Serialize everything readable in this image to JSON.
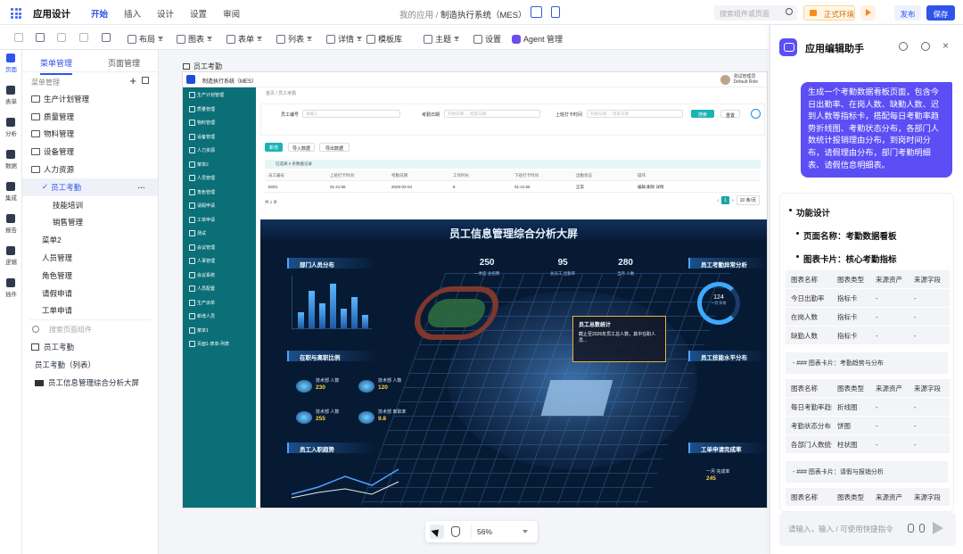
{
  "app": {
    "title": "应用设计",
    "breadcrumb_parent": "我的应用",
    "breadcrumb_sep": "/",
    "breadcrumb_current": "制造执行系统（MES）"
  },
  "top_tabs": [
    "开始",
    "插入",
    "设计",
    "设置",
    "审阅"
  ],
  "top_right": {
    "search_placeholder": "搜索组件或页面",
    "env_label": "正式环境",
    "publish": "发布",
    "save": "保存"
  },
  "toolbar": [
    {
      "label": "布局",
      "icon": "layout-icon"
    },
    {
      "label": "图表",
      "icon": "chart-icon"
    },
    {
      "label": "表单",
      "icon": "form-icon"
    },
    {
      "label": "列表",
      "icon": "list-icon"
    },
    {
      "label": "详情",
      "icon": "detail-icon"
    },
    {
      "label": "模板库",
      "icon": "template-icon"
    },
    {
      "label": "主题",
      "icon": "theme-icon"
    },
    {
      "label": "设置",
      "icon": "settings-icon"
    },
    {
      "label": "Agent 管理",
      "icon": "agent-icon"
    }
  ],
  "rail": [
    "页面",
    "表单",
    "分析",
    "数据",
    "集成",
    "报告",
    "逻辑",
    "插件"
  ],
  "left_panel": {
    "tabs": [
      "菜单管理",
      "页面管理"
    ],
    "header": "菜单管理",
    "tree": [
      {
        "label": "生产计划管理",
        "level": 0,
        "folder": true
      },
      {
        "label": "质量管理",
        "level": 0,
        "folder": true
      },
      {
        "label": "物料管理",
        "level": 0,
        "folder": true
      },
      {
        "label": "设备管理",
        "level": 0,
        "folder": true
      },
      {
        "label": "人力资源",
        "level": 0,
        "folder": true
      },
      {
        "label": "员工考勤",
        "level": 1,
        "selected": true
      },
      {
        "label": "技能培训",
        "level": 2
      },
      {
        "label": "销售管理",
        "level": 2
      },
      {
        "label": "菜单2",
        "level": 1
      },
      {
        "label": "人员管理",
        "level": 1
      },
      {
        "label": "角色管理",
        "level": 1
      },
      {
        "label": "请假申请",
        "level": 1
      },
      {
        "label": "工单申请",
        "level": 1
      }
    ],
    "search_placeholder": "搜索页面组件",
    "pages": [
      "员工考勤",
      "员工考勤（列表）",
      "员工信息管理综合分析大屏"
    ]
  },
  "canvas": {
    "page_title": "员工考勤",
    "mes_title": "制造执行系统（MES）",
    "user_name": "测试管理员",
    "user_role": "Default Role",
    "mes_menu": [
      "生产计划管理",
      "质量管理",
      "物料管理",
      "设备管理",
      "人力资源",
      "菜单2",
      "人员管理",
      "角色管理",
      "请假申请",
      "工单申请",
      "测试",
      "会议管理",
      "人事管理",
      "会议系统",
      "人员配置",
      "生产派单",
      "新增人员",
      "菜单1",
      "页面1-表单-列表"
    ],
    "crumb": "首页 / 员工考勤",
    "filter": {
      "emp_no": "员工编号",
      "emp_no_ph": "请输入",
      "date": "考勤日期",
      "date_start": "开始日期",
      "date_end": "结束日期",
      "punch": "上班打卡时间",
      "search": "搜索",
      "reset": "重置"
    },
    "list": {
      "add": "新增",
      "import": "导入数据",
      "export": "导出数据",
      "selected": "已选择 0 条数据记录",
      "headers": [
        "员工编号",
        "上班打卡时间",
        "考勤日期",
        "工作时长",
        "下班打卡时间",
        "出勤状态",
        "操作"
      ],
      "row": [
        "E001",
        "01:41:55",
        "2026-02-04",
        "8",
        "01:41:55",
        "正常",
        "编辑  删除  详情"
      ],
      "total": "共 1 条",
      "page": "1",
      "page_size": "10 条/页"
    },
    "dashboard": {
      "title": "员工信息管理综合分析大屏",
      "sections": [
        "部门人员分布",
        "在职与离职比例",
        "员工入职趋势",
        "员工考勤异常分析",
        "员工技能水平分布",
        "工单申请完成率"
      ],
      "kpis": [
        {
          "value": "250",
          "label": "一季度 总招聘"
        },
        {
          "value": "95",
          "label": "总员工 出勤率"
        },
        {
          "value": "280",
          "label": "当月 人数"
        }
      ],
      "popup_title": "员工总数统计",
      "popup_text": "截止至2026年员工总人数，其中在职人员...",
      "ring_value": "124",
      "ring_label": "一月 异常",
      "peds": [
        {
          "label": "技术部 人数",
          "value": "230"
        },
        {
          "label": "技术部 人数",
          "value": "120"
        },
        {
          "label": "技术部 人数",
          "value": "255"
        },
        {
          "label": "技术部 离职率",
          "value": "9.8"
        }
      ],
      "completion_value": "245",
      "completion_label": "一月 完成率"
    }
  },
  "zoom": {
    "value": "56%"
  },
  "assistant": {
    "title": "应用编辑助手",
    "user_message": "生成一个考勤数据看板页面，包含今日出勤率、在岗人数、缺勤人数、迟到人数等指标卡，搭配每日考勤率趋势折线图、考勤状态分布，各部门人数统计报销理由分布，到岗时间分布，请假理由分布，部门考勤明细表、请假信息明细表。",
    "reply": {
      "h1": "功能设计",
      "page_name": "页面名称：考勤数据看板",
      "card_title": "图表卡片：核心考勤指标",
      "table_headers": [
        "图表名称",
        "图表类型",
        "来源资产",
        "来源字段"
      ],
      "table1": [
        [
          "今日出勤率",
          "指标卡",
          "-",
          "-"
        ],
        [
          "在岗人数",
          "指标卡",
          "-",
          "-"
        ],
        [
          "缺勤人数",
          "指标卡",
          "-",
          "-"
        ]
      ],
      "note1": "- ### 图表卡片：考勤趋势与分布",
      "table2": [
        [
          "每日考勤率趋势",
          "折线图",
          "-",
          "-"
        ],
        [
          "考勤状态分布",
          "饼图",
          "-",
          "-"
        ],
        [
          "各部门人数统计",
          "柱状图",
          "-",
          "-"
        ]
      ],
      "note2": "- ### 图表卡片：请假与报销分析",
      "table3_headers": [
        "图表名称",
        "图表类型",
        "来源资产",
        "来源字段"
      ]
    },
    "input_placeholder": "请输入，输入 / 可使用快捷指令"
  }
}
